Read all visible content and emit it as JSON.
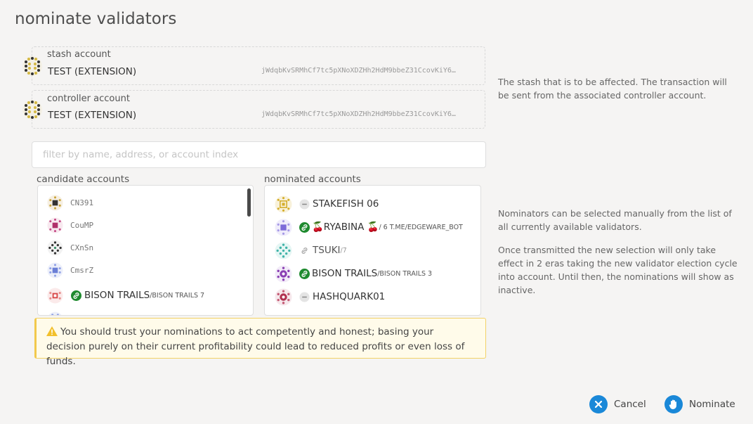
{
  "page": {
    "title": "nominate validators"
  },
  "stash": {
    "label": "stash account",
    "name": "TEST (EXTENSION)",
    "address": "jWdqbKvSRMhCf7tc5pXNoXDZHh2HdM9bbeZ31CcovKiY6…",
    "icon": "identicon"
  },
  "controller": {
    "label": "controller account",
    "name": "TEST (EXTENSION)",
    "address": "jWdqbKvSRMhCf7tc5pXNoXDZHh2HdM9bbeZ31CcovKiY6…",
    "icon": "identicon"
  },
  "help": {
    "stash": "The stash that is to be affected. The transaction will be sent from the associated controller account.",
    "nominators": "Nominators can be selected manually from the list of all currently available validators.",
    "eras": "Once transmitted the new selection will only take effect in 2 eras taking the new validator election cycle into account. Until then, the nominations will show as inactive."
  },
  "filter": {
    "placeholder": "filter by name, address, or account index",
    "value": ""
  },
  "candidates": {
    "label": "candidate accounts",
    "items": [
      {
        "name": "CN391",
        "icon": "identicon"
      },
      {
        "name": "CouMP",
        "icon": "identicon"
      },
      {
        "name": "CXnSn",
        "icon": "identicon"
      },
      {
        "name": "CmsrZ",
        "icon": "identicon"
      },
      {
        "name": "BISON TRAILS",
        "sub": "/BISON TRAILS 7",
        "badge": "linked"
      }
    ]
  },
  "nominated": {
    "label": "nominated accounts",
    "items": [
      {
        "name": "STAKEFISH 06",
        "badge": "none"
      },
      {
        "name": "🍒RYABINA 🍒",
        "sub": " / 6 T.ME/EDGEWARE_BOT",
        "badge": "linked"
      },
      {
        "name": "TSUKI",
        "sub": "/7",
        "badge": "grey-link"
      },
      {
        "name": "BISON TRAILS",
        "sub": "/BISON TRAILS 3",
        "badge": "linked"
      },
      {
        "name": "HASHQUARK01",
        "badge": "none"
      }
    ]
  },
  "warning": {
    "text": "You should trust your nominations to act competently and honest; basing your decision purely on their current profitability could lead to reduced profits or even loss of funds."
  },
  "actions": {
    "cancel": "Cancel",
    "nominate": "Nominate"
  },
  "colors": {
    "accent": "#1a88d8",
    "linked": "#1e8a2e",
    "warning_border": "#f2c94c"
  }
}
